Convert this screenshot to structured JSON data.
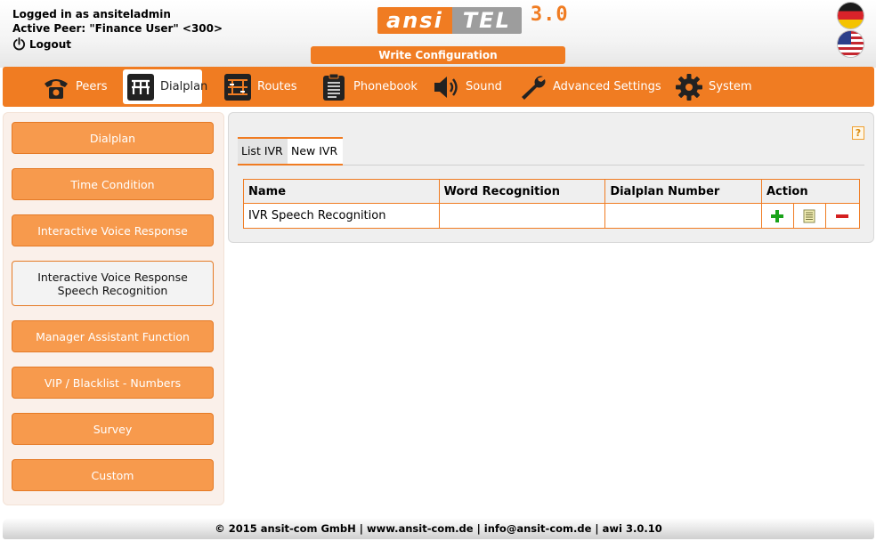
{
  "header": {
    "logged_in": "Logged in as ansiteladmin",
    "active_peer": "Active Peer: \"Finance User\" <300>",
    "logout": "Logout",
    "logo_ansi": "ansi",
    "logo_tel": "TEL",
    "logo_version": "3.0",
    "write_config": "Write Configuration"
  },
  "nav": {
    "items": [
      {
        "label": "Peers",
        "icon": "telephone-icon"
      },
      {
        "label": "Dialplan",
        "icon": "dialplan-icon",
        "active": true
      },
      {
        "label": "Routes",
        "icon": "routes-icon"
      },
      {
        "label": "Phonebook",
        "icon": "phonebook-icon"
      },
      {
        "label": "Sound",
        "icon": "speaker-icon"
      },
      {
        "label": "Advanced Settings",
        "icon": "wrench-icon"
      },
      {
        "label": "System",
        "icon": "gear-icon"
      }
    ]
  },
  "sidebar": {
    "items": [
      {
        "label": "Dialplan"
      },
      {
        "label": "Time Condition"
      },
      {
        "label": "Interactive Voice Response"
      },
      {
        "label_line1": "Interactive Voice Response",
        "label_line2": "Speech Recognition",
        "active": true
      },
      {
        "label": "Manager Assistant Function"
      },
      {
        "label": "VIP / Blacklist - Numbers"
      },
      {
        "label": "Survey"
      },
      {
        "label": "Custom"
      }
    ]
  },
  "main": {
    "help": "?",
    "tabs": [
      {
        "label": "List IVR"
      },
      {
        "label": "New IVR"
      }
    ],
    "table": {
      "columns": [
        "Name",
        "Word Recognition",
        "Dialplan Number",
        "Action"
      ],
      "rows": [
        {
          "name": "IVR Speech Recognition",
          "word_recognition": "",
          "dialplan_number": ""
        }
      ]
    }
  },
  "colors": {
    "accent": "#f07c22",
    "sidebar_button": "#f79a4d"
  },
  "footer": {
    "text": "© 2015 ansit-com GmbH | www.ansit-com.de | info@ansit-com.de | awi 3.0.10"
  }
}
